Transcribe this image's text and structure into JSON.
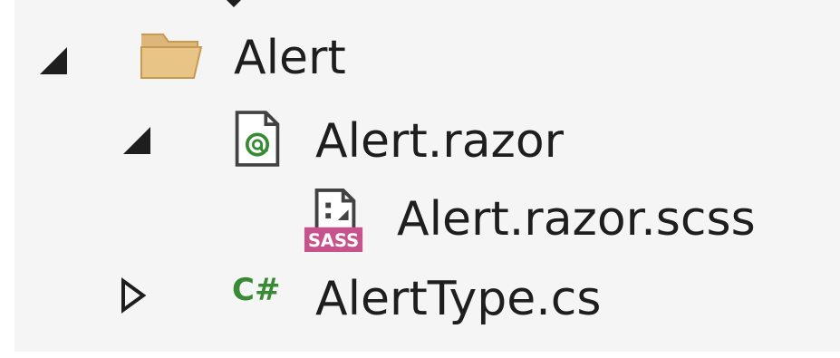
{
  "tree": {
    "items": [
      {
        "label": "Alert",
        "type": "folder",
        "icon": "folder-open-icon",
        "expanded": true
      },
      {
        "label": "Alert.razor",
        "type": "razor-file",
        "icon": "razor-file-icon",
        "expanded": true
      },
      {
        "label": "Alert.razor.scss",
        "type": "sass-file",
        "icon": "sass-file-icon",
        "icon_badge": "SASS"
      },
      {
        "label": "AlertType.cs",
        "type": "csharp-file",
        "icon": "csharp-file-icon",
        "icon_text": "C#",
        "expanded": false
      }
    ]
  },
  "colors": {
    "panel_background": "#f5f5f5",
    "text": "#1e1e1e",
    "folder": "#dcb67a",
    "razor_green": "#388a34",
    "sass_pink": "#c6538c",
    "csharp_green": "#388a34"
  }
}
